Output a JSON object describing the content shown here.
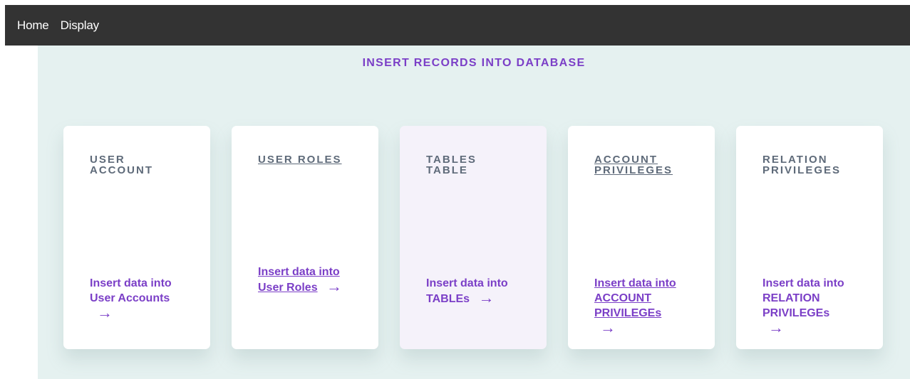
{
  "nav": {
    "home_label": "Home",
    "display_label": "Display"
  },
  "page": {
    "title": "INSERT RECORDS INTO DATABASE"
  },
  "cards": [
    {
      "title": "USER\nACCOUNT",
      "link_line1": "Insert data into",
      "link_line2": "User Accounts"
    },
    {
      "title": "USER ROLES",
      "link_line1": "Insert data into",
      "link_line2": "User Roles"
    },
    {
      "title": "TABLES\nTABLE",
      "link_line1": "Insert data into",
      "link_line2": "TABLEs"
    },
    {
      "title": "ACCOUNT\nPRIVILEGES",
      "link_line1": "Insert data into",
      "link_line2": "ACCOUNT",
      "link_line3": "PRIVILEGEs"
    },
    {
      "title": "RELATION\nPRIVILEGES",
      "link_line1": "Insert data into",
      "link_line2": "RELATION",
      "link_line3": "PRIVILEGEs"
    }
  ],
  "icons": {
    "arrow": "→"
  },
  "colors": {
    "nav_bg": "#333333",
    "main_bg": "#e5f1f0",
    "accent": "#7b3fc7",
    "card_title": "#5e6a79",
    "highlight_card_bg": "#f5f2fa"
  }
}
